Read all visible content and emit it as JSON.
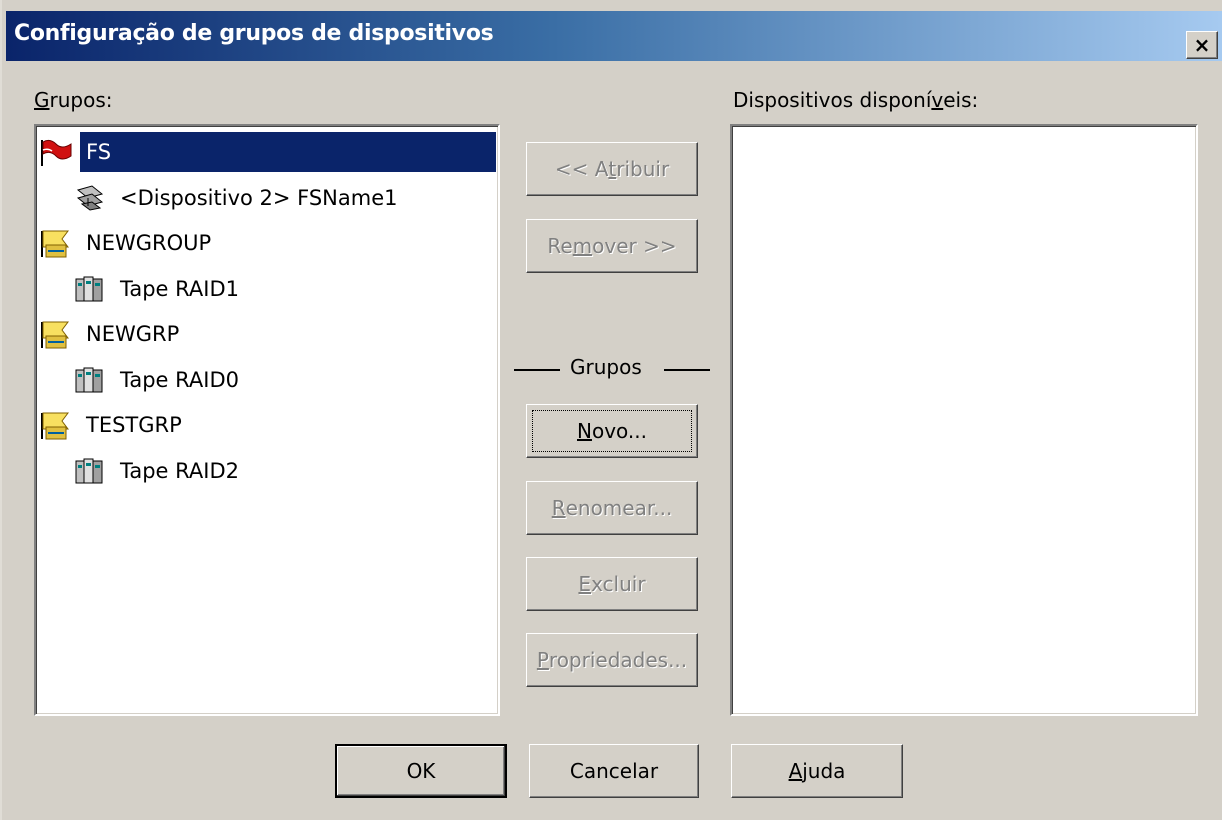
{
  "window": {
    "title": "Configuração de grupos de dispositivos",
    "close_label": "×"
  },
  "groups_label": {
    "accel": "G",
    "rest": "rupos:"
  },
  "available_label": {
    "pre": "Dispositivos disponí",
    "accel": "v",
    "post": "eis:"
  },
  "tree": [
    {
      "label": "FS",
      "icon": "red-flag-icon",
      "level": 0,
      "selected": true
    },
    {
      "label": "<Dispositivo  2> FSName1",
      "icon": "device-icon",
      "level": 1
    },
    {
      "label": "NEWGROUP",
      "icon": "group-folder-icon",
      "level": 0
    },
    {
      "label": "Tape RAID1",
      "icon": "tape-raid-icon",
      "level": 1
    },
    {
      "label": "NEWGRP",
      "icon": "group-folder-icon",
      "level": 0
    },
    {
      "label": "Tape RAID0",
      "icon": "tape-raid-icon",
      "level": 1
    },
    {
      "label": "TESTGRP",
      "icon": "group-folder-icon",
      "level": 0
    },
    {
      "label": "Tape RAID2",
      "icon": "tape-raid-icon",
      "level": 1
    }
  ],
  "buttons": {
    "assign": {
      "pre": "<< A",
      "accel": "t",
      "post": "ribuir"
    },
    "remove": {
      "pre": "Re",
      "accel": "m",
      "post": "over >>"
    },
    "groups_section": "Grupos",
    "new": {
      "pre": "",
      "accel": "N",
      "post": "ovo..."
    },
    "rename": {
      "pre": "",
      "accel": "R",
      "post": "enomear..."
    },
    "delete": {
      "pre": "",
      "accel": "E",
      "post": "xcluir"
    },
    "properties": {
      "pre": "",
      "accel": "P",
      "post": "ropriedades..."
    },
    "ok": "OK",
    "cancel": "Cancelar",
    "help": {
      "pre": "",
      "accel": "A",
      "post": "juda"
    }
  },
  "colors": {
    "selection": "#0a246a",
    "face": "#d4d0c8",
    "titlebar_start": "#0a246a",
    "titlebar_end": "#a6caf0"
  }
}
